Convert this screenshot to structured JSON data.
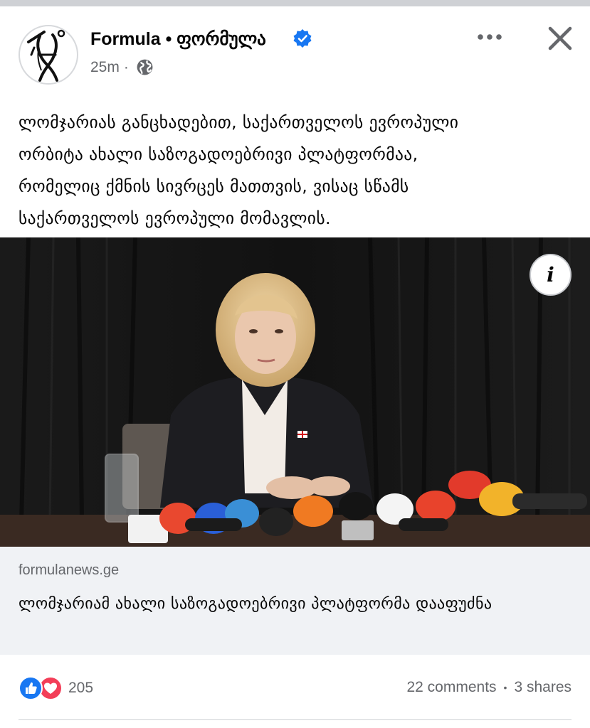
{
  "post": {
    "page_name": "Formula • ფორმულა",
    "time": "25m",
    "separator": "·",
    "privacy_icon": "globe-icon",
    "text_lines": [
      "ლომჯარიას განცხადებით, საქართველოს ევროპული",
      "ორბიტა ახალი საზოგადოებრივი პლატფორმაა,",
      "რომელიც ქმნის სივრცეს მათთვის, ვისაც სწამს",
      "საქართველოს ევროპული მომავლის."
    ]
  },
  "link_preview": {
    "domain": "formulanews.ge",
    "title": "ლომჯარიამ ახალი საზოგადოებრივი პლატფორმა დააფუძნა",
    "info_label": "i"
  },
  "footer": {
    "reaction_count": "205",
    "reaction_icons": [
      "like-icon",
      "love-icon"
    ],
    "comments": "22 comments",
    "separator": "•",
    "shares": "3 shares"
  },
  "colors": {
    "accent": "#1877f2",
    "love": "#f33e58",
    "secondary_text": "#65676b",
    "card_bg": "#f0f2f5"
  }
}
